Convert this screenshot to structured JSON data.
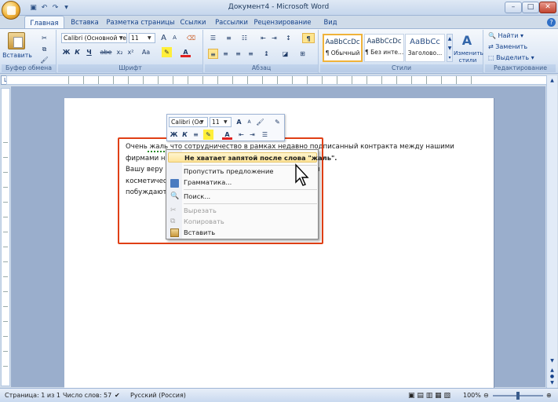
{
  "window": {
    "title": "Документ4 - Microsoft Word"
  },
  "tabs": [
    "Главная",
    "Вставка",
    "Разметка страницы",
    "Ссылки",
    "Рассылки",
    "Рецензирование",
    "Вид"
  ],
  "clipboard": {
    "paste_label": "Вставить",
    "group_label": "Буфер обмена"
  },
  "font": {
    "name": "Calibri (Основной те",
    "size": "11",
    "bold": "Ж",
    "italic": "К",
    "underline": "Ч",
    "strike": "abe",
    "subscript": "x₂",
    "superscript": "x²",
    "change_case": "Aa",
    "grow": "A",
    "shrink": "A",
    "group_label": "Шрифт"
  },
  "paragraph": {
    "group_label": "Абзац"
  },
  "styles": {
    "items": [
      {
        "preview": "AaBbCcDc",
        "name": "¶ Обычный"
      },
      {
        "preview": "AaBbCcDc",
        "name": "¶ Без инте..."
      },
      {
        "preview": "AaBbCc",
        "name": "Заголово..."
      }
    ],
    "change_label": "Изменить стили",
    "group_label": "Стили"
  },
  "editing": {
    "find": "Найти",
    "replace": "Заменить",
    "select": "Выделить",
    "group_label": "Редактирование"
  },
  "document": {
    "lines": [
      "Очень жаль что сотрудничество в рамках недавно подписанный контракта между нашими",
      "фирмами не                                                                 сложившейся ситуации и высоко ценим",
      "Вашу веру в                                                                  разработки крупнейших производителей",
      "косметичес                                                                  выбранного нами пути, в то же время,",
      "побуждают                                                                  кругами во многих странах мира."
    ]
  },
  "mini_toolbar": {
    "font": "Calibri (Ос",
    "size": "11",
    "bold": "Ж",
    "italic": "К"
  },
  "context_menu": {
    "suggestion": "Не хватает запятой после слова \"жаль\".",
    "ignore": "Пропустить предложение",
    "grammar": "Грамматика...",
    "lookup": "Поиск...",
    "cut": "Вырезать",
    "copy": "Копировать",
    "paste": "Вставить"
  },
  "status": {
    "page": "Страница: 1 из 1",
    "words": "Число слов: 57",
    "language": "Русский (Россия)",
    "zoom": "100%"
  }
}
